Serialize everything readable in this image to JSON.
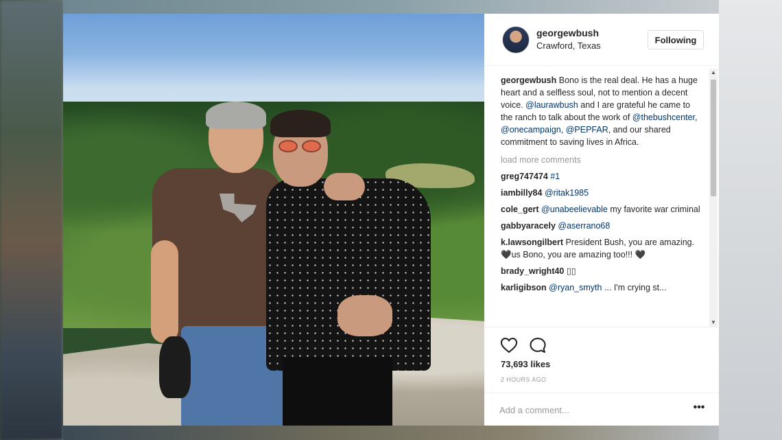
{
  "post": {
    "username": "georgewbush",
    "location": "Crawford, Texas",
    "follow_label": "Following",
    "caption": {
      "user": "georgewbush",
      "t1": " Bono is the real deal. He has a huge heart and a selfless soul, not to mention a decent voice. ",
      "m1": "@laurawbush",
      "t2": " and I are grateful he came to the ranch to talk about the work of ",
      "m2": "@thebushcenter",
      "t3": ", ",
      "m3": "@onecampaign",
      "t4": ", ",
      "m4": "@PEPFAR",
      "t5": ", and our shared commitment to saving lives in Africa."
    },
    "load_more": "load more comments",
    "comments": [
      {
        "user": "greg747474",
        "mention": "#1",
        "text": ""
      },
      {
        "user": "iambilly84",
        "mention": "@ritak1985",
        "text": ""
      },
      {
        "user": "cole_gert",
        "mention": "@unabeelievable",
        "text": " my favorite war criminal"
      },
      {
        "user": "gabbyaracely",
        "mention": "@aserrano68",
        "text": ""
      },
      {
        "user": "k.lawsongilbert",
        "mention": "",
        "text": " President Bush, you are amazing.🖤us Bono, you are amazing too!!! 🖤"
      },
      {
        "user": "brady_wright40",
        "mention": "",
        "text": " ▯▯"
      },
      {
        "user": "karligibson",
        "mention": "@ryan_smyth",
        "text": " ... I'm crying st..."
      }
    ],
    "likes": "73,693 likes",
    "time": "2 HOURS AGO",
    "add_comment_placeholder": "Add a comment...",
    "more_label": "•••"
  },
  "icons": {
    "like": "heart-icon",
    "comment": "comment-icon",
    "more": "more-options-icon"
  }
}
